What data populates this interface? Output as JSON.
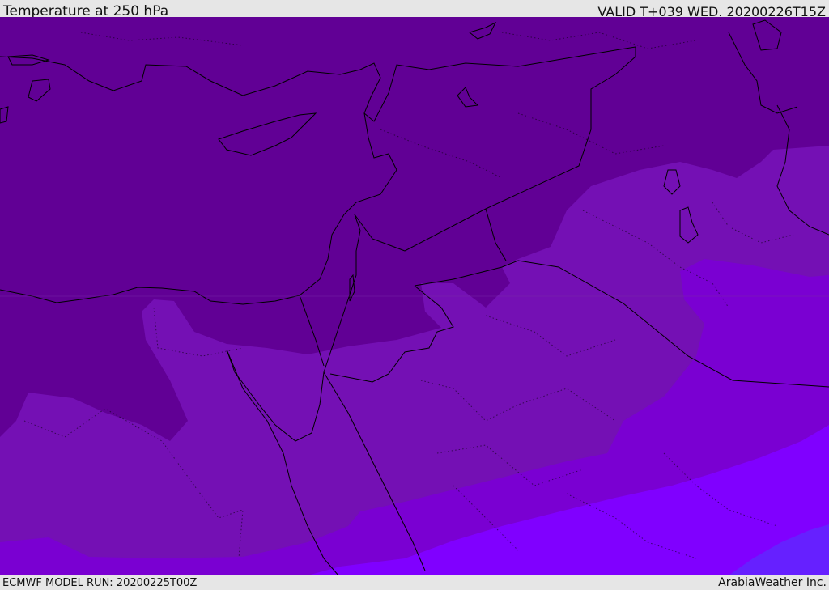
{
  "header": {
    "title": "Temperature at 250 hPa",
    "valid": "VALID T+039 WED. 20200226T15Z"
  },
  "footer": {
    "model_run": "ECMWF MODEL RUN: 20200225T00Z",
    "credit": "ArabiaWeather Inc."
  },
  "map": {
    "region": "Eastern Mediterranean and Middle East",
    "field": "temperature",
    "level_hPa": 250,
    "color_bands": [
      "#610095",
      "#6c00a8",
      "#7710b8",
      "#7b00d6",
      "#8000ff",
      "#6622ff"
    ],
    "boundary_color": "#000000"
  }
}
